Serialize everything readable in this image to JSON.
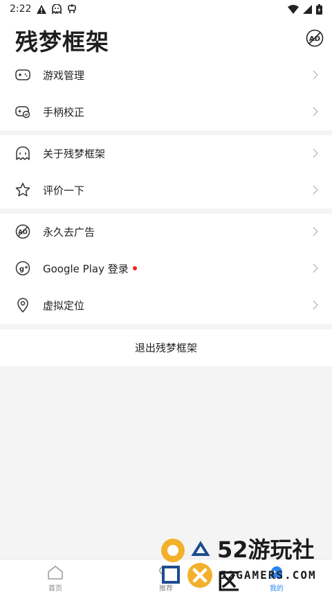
{
  "status_bar": {
    "time": "2:22"
  },
  "header": {
    "title": "残梦框架",
    "no_ad_icon": "no-ads-icon"
  },
  "groups": [
    {
      "items": [
        {
          "label": "游戏管理",
          "icon": "gamepad-icon"
        },
        {
          "label": "手柄校正",
          "icon": "controller-calibrate-icon"
        }
      ]
    },
    {
      "items": [
        {
          "label": "关于残梦框架",
          "icon": "ghost-icon"
        },
        {
          "label": "评价一下",
          "icon": "star-icon"
        }
      ]
    },
    {
      "items": [
        {
          "label": "永久去广告",
          "icon": "no-ads-icon"
        },
        {
          "label": "Google Play 登录",
          "icon": "google-plus-icon",
          "badge": "red-dot"
        },
        {
          "label": "虚拟定位",
          "icon": "location-pin-icon"
        }
      ]
    }
  ],
  "logout_label": "退出残梦框架",
  "tabbar": {
    "tabs": [
      {
        "label": "首页",
        "icon": "home-icon",
        "active": false
      },
      {
        "label": "推荐",
        "icon": "recommend-icon",
        "active": false
      },
      {
        "label": "我的",
        "icon": "profile-icon",
        "active": true
      }
    ]
  },
  "watermark": {
    "big": "52游玩社区",
    "small": "52GAMERS.COM"
  },
  "colors": {
    "accent": "#2b86f0",
    "badge": "#ee2222",
    "background": "#f4f4f4"
  }
}
